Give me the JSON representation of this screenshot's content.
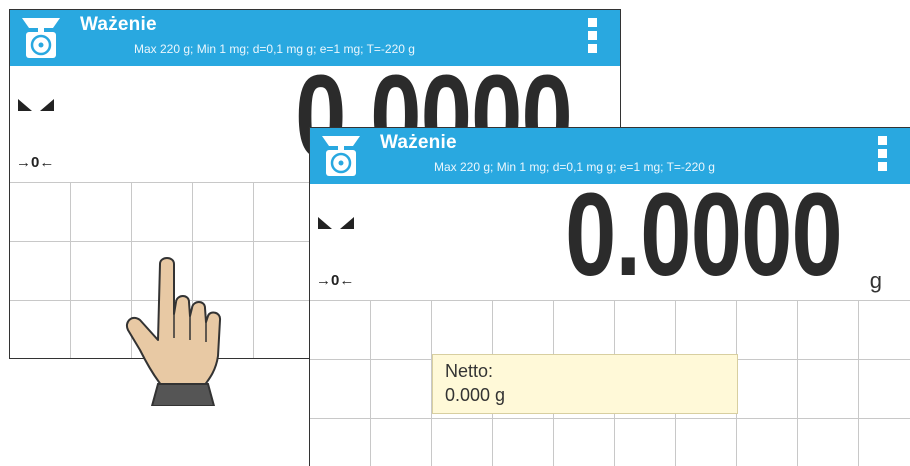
{
  "back_screen": {
    "title": "Ważenie",
    "subtitle": "Max 220 g; Min 1 mg; d=0,1 mg g; e=1 mg; T=-220 g",
    "reading": "0.0000",
    "zero_indicator": "→0←"
  },
  "front_screen": {
    "title": "Ważenie",
    "subtitle": "Max 220 g; Min 1 mg; d=0,1 mg g; e=1 mg; T=-220 g",
    "reading": "0.0000",
    "unit": "g",
    "zero_indicator": "→0←",
    "net_label": "Netto:",
    "net_value": "0.000 g"
  },
  "colors": {
    "header_blue": "#29a8e0",
    "net_box": "#fff9d8",
    "hand_skin": "#e8c9a4"
  },
  "icons": [
    "scale-icon",
    "menu-icon",
    "stability-icon",
    "hand-pointer-icon"
  ]
}
